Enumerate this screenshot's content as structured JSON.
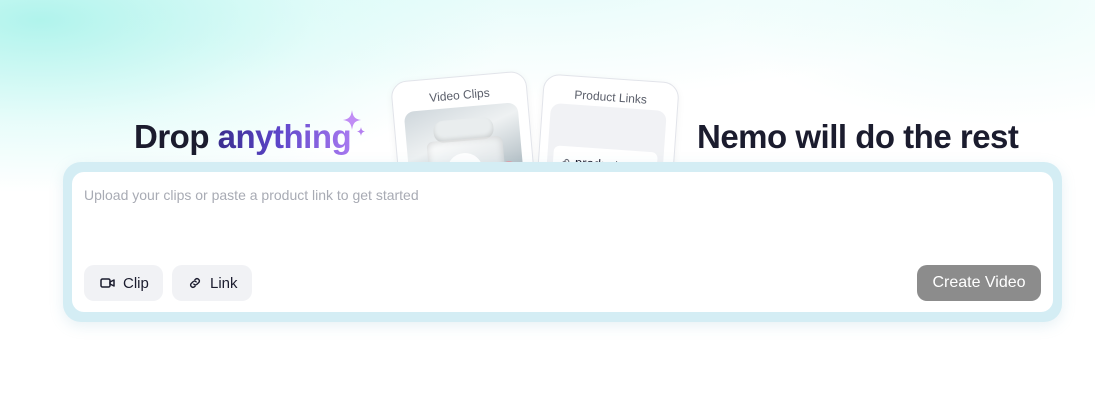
{
  "hero": {
    "headline_left_prefix": "Drop ",
    "headline_left_highlight": "anything",
    "headline_right": "Nemo will do the rest"
  },
  "cards": {
    "video": {
      "title": "Video Clips"
    },
    "product": {
      "title": "Product Links",
      "chip_text": "product.com"
    }
  },
  "composer": {
    "placeholder": "Upload your clips or paste a product link to get started",
    "clip_label": "Clip",
    "link_label": "Link",
    "create_label": "Create Video"
  },
  "icons": {
    "sparkle": "sparkle-icon",
    "play": "play-icon",
    "link": "link-icon",
    "video": "video-camera-icon"
  },
  "colors": {
    "accent_gradient_start": "#3b2e8f",
    "accent_gradient_end": "#a879f0",
    "panel_border": "#d4edf4",
    "create_button": "#8c8c8c"
  }
}
